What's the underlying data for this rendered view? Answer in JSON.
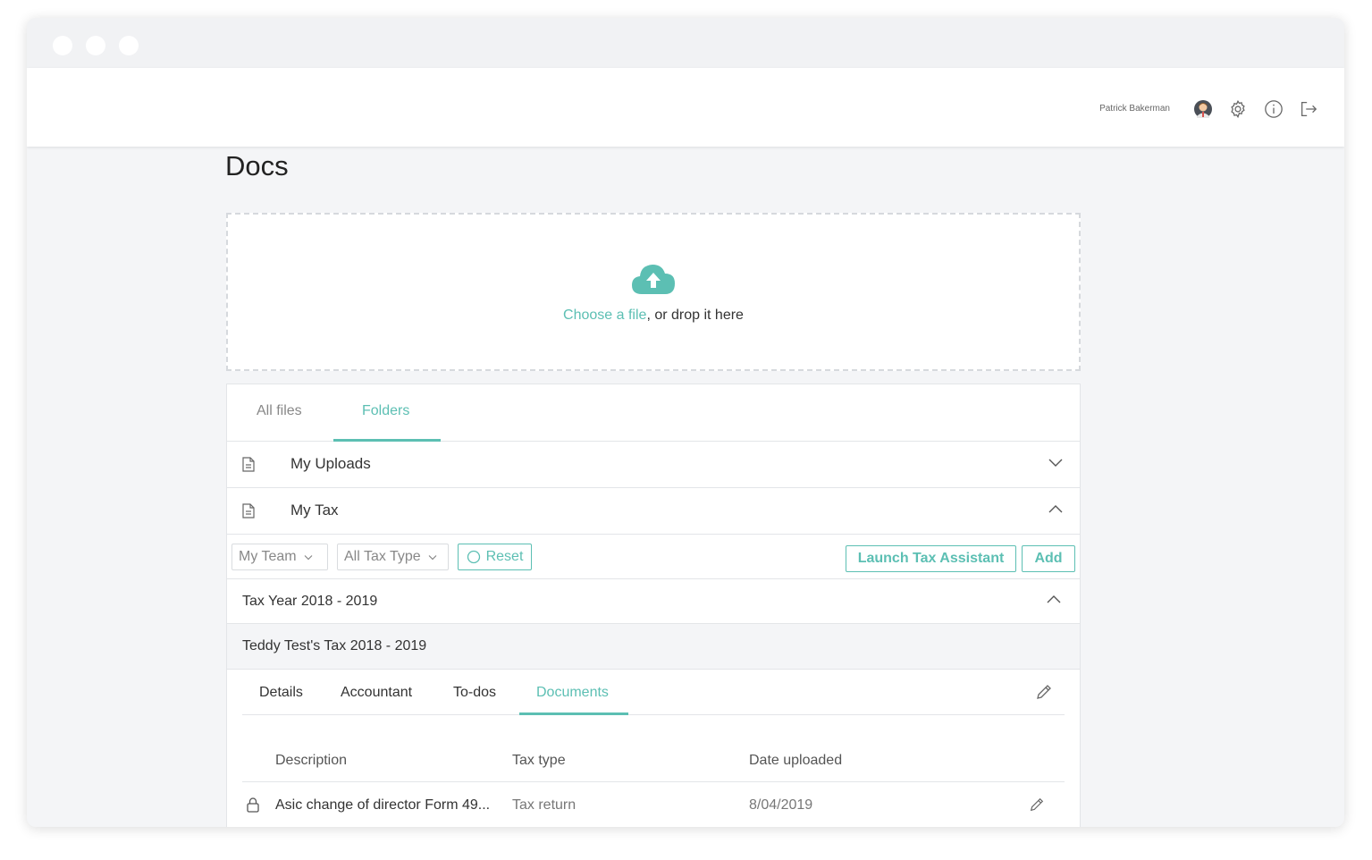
{
  "header": {
    "username": "Patrick Bakerman",
    "icons": [
      "avatar",
      "gear-icon",
      "info-icon",
      "logout-icon"
    ]
  },
  "page": {
    "title": "Docs"
  },
  "dropzone": {
    "link_text": "Choose a file",
    "rest_text": ", or drop it here",
    "icon": "cloud-upload-icon"
  },
  "tabs": [
    {
      "label": "All files",
      "active": false
    },
    {
      "label": "Folders",
      "active": true
    }
  ],
  "folders": [
    {
      "name": "My Uploads",
      "expanded": false
    },
    {
      "name": "My Tax",
      "expanded": true
    }
  ],
  "filters": {
    "team": "My Team",
    "tax_type": "All Tax Type",
    "reset_label": "Reset",
    "launch_label": "Launch Tax Assistant",
    "add_label": "Add"
  },
  "tax_year": {
    "label": "Tax Year 2018 - 2019"
  },
  "tax_return": {
    "label": "Teddy Test's Tax 2018 - 2019",
    "tabs": [
      {
        "label": "Details",
        "active": false
      },
      {
        "label": "Accountant",
        "active": false
      },
      {
        "label": "To-dos",
        "active": false
      },
      {
        "label": "Documents",
        "active": true
      }
    ]
  },
  "documents_table": {
    "columns": [
      "Description",
      "Tax type",
      "Date uploaded"
    ],
    "rows": [
      {
        "description": "Asic change of director Form 49...",
        "tax_type": "Tax return",
        "date_uploaded": "8/04/2019"
      }
    ]
  },
  "colors": {
    "accent": "#5cbfb3",
    "text": "#333333",
    "border": "#e3e5e8"
  }
}
